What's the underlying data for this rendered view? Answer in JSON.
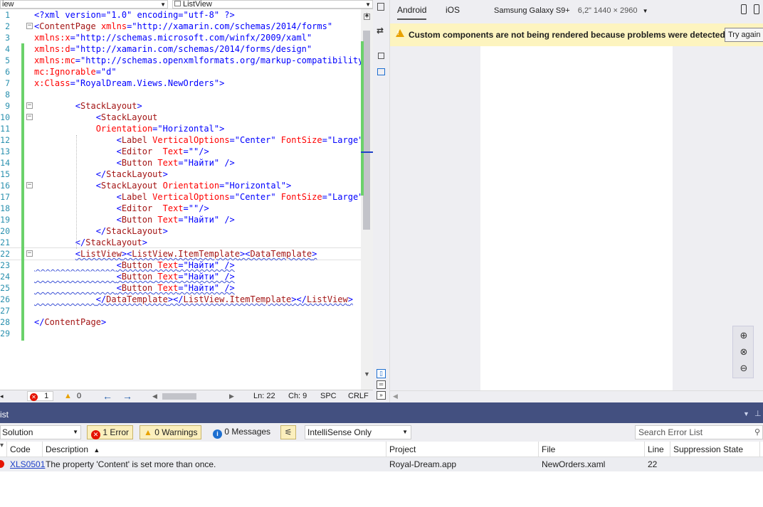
{
  "editor": {
    "combo_left": "iew",
    "combo_right": "ListView",
    "lines": [
      {
        "n": "1",
        "fold": "",
        "parts": [
          {
            "t": "<?xml version=\"1.0\" encoding=\"utf-8\" ?>",
            "c": "b"
          }
        ]
      },
      {
        "n": "2",
        "fold": "⊟",
        "parts": [
          {
            "t": "<",
            "c": "b"
          },
          {
            "t": "ContentPage",
            "c": "r"
          },
          {
            "t": " xmlns",
            "c": "a"
          },
          {
            "t": "=\"http://xamarin.com/schemas/2014/forms\"",
            "c": "v"
          }
        ]
      },
      {
        "n": "3",
        "fold": "",
        "parts": [
          {
            "t": "xmlns:x",
            "c": "a"
          },
          {
            "t": "=\"http://schemas.microsoft.com/winfx/2009/xaml\"",
            "c": "v"
          }
        ]
      },
      {
        "n": "4",
        "fold": "",
        "parts": [
          {
            "t": "xmlns:d",
            "c": "a"
          },
          {
            "t": "=\"http://xamarin.com/schemas/2014/forms/design\"",
            "c": "v"
          }
        ]
      },
      {
        "n": "5",
        "fold": "",
        "parts": [
          {
            "t": "xmlns:mc",
            "c": "a"
          },
          {
            "t": "=\"http://schemas.openxmlformats.org/markup-compatibility/2",
            "c": "v"
          }
        ]
      },
      {
        "n": "6",
        "fold": "",
        "parts": [
          {
            "t": "mc:Ignorable",
            "c": "a"
          },
          {
            "t": "=\"d\"",
            "c": "v"
          }
        ]
      },
      {
        "n": "7",
        "fold": "",
        "parts": [
          {
            "t": "x:Class",
            "c": "a"
          },
          {
            "t": "=\"RoyalDream.Views.NewOrders\">",
            "c": "v"
          }
        ]
      },
      {
        "n": "8",
        "fold": "",
        "parts": []
      },
      {
        "n": "9",
        "fold": "⊟",
        "parts": [
          {
            "t": "        <",
            "c": "b"
          },
          {
            "t": "StackLayout",
            "c": "r"
          },
          {
            "t": ">",
            "c": "b"
          }
        ]
      },
      {
        "n": "10",
        "fold": "⊟",
        "parts": [
          {
            "t": "            <",
            "c": "b"
          },
          {
            "t": "StackLayout",
            "c": "r"
          }
        ]
      },
      {
        "n": "11",
        "fold": "",
        "parts": [
          {
            "t": "            Orientation",
            "c": "a"
          },
          {
            "t": "=\"Horizontal\">",
            "c": "v"
          }
        ]
      },
      {
        "n": "12",
        "fold": "",
        "parts": [
          {
            "t": "                <",
            "c": "b"
          },
          {
            "t": "Label",
            "c": "r"
          },
          {
            "t": " VerticalOptions",
            "c": "a"
          },
          {
            "t": "=\"Center\"",
            "c": "v"
          },
          {
            "t": " FontSize",
            "c": "a"
          },
          {
            "t": "=\"Large\" ",
            "c": "v"
          }
        ]
      },
      {
        "n": "13",
        "fold": "",
        "parts": [
          {
            "t": "                <",
            "c": "b"
          },
          {
            "t": "Editor",
            "c": "r"
          },
          {
            "t": "  Text",
            "c": "a"
          },
          {
            "t": "=\"\"/>",
            "c": "v"
          }
        ]
      },
      {
        "n": "14",
        "fold": "",
        "parts": [
          {
            "t": "                <",
            "c": "b"
          },
          {
            "t": "Button",
            "c": "r"
          },
          {
            "t": " Text",
            "c": "a"
          },
          {
            "t": "=\"Найти\" />",
            "c": "v"
          }
        ]
      },
      {
        "n": "15",
        "fold": "",
        "parts": [
          {
            "t": "            </",
            "c": "b"
          },
          {
            "t": "StackLayout",
            "c": "r"
          },
          {
            "t": ">",
            "c": "b"
          }
        ]
      },
      {
        "n": "16",
        "fold": "⊟",
        "parts": [
          {
            "t": "            <",
            "c": "b"
          },
          {
            "t": "StackLayout",
            "c": "r"
          },
          {
            "t": " Orientation",
            "c": "a"
          },
          {
            "t": "=\"Horizontal\">",
            "c": "v"
          }
        ]
      },
      {
        "n": "17",
        "fold": "",
        "parts": [
          {
            "t": "                <",
            "c": "b"
          },
          {
            "t": "Label",
            "c": "r"
          },
          {
            "t": " VerticalOptions",
            "c": "a"
          },
          {
            "t": "=\"Center\"",
            "c": "v"
          },
          {
            "t": " FontSize",
            "c": "a"
          },
          {
            "t": "=\"Large\" ",
            "c": "v"
          }
        ]
      },
      {
        "n": "18",
        "fold": "",
        "parts": [
          {
            "t": "                <",
            "c": "b"
          },
          {
            "t": "Editor",
            "c": "r"
          },
          {
            "t": "  Text",
            "c": "a"
          },
          {
            "t": "=\"\"/>",
            "c": "v"
          }
        ]
      },
      {
        "n": "19",
        "fold": "",
        "parts": [
          {
            "t": "                <",
            "c": "b"
          },
          {
            "t": "Button",
            "c": "r"
          },
          {
            "t": " Text",
            "c": "a"
          },
          {
            "t": "=\"Найти\" />",
            "c": "v"
          }
        ]
      },
      {
        "n": "20",
        "fold": "",
        "parts": [
          {
            "t": "            </",
            "c": "b"
          },
          {
            "t": "StackLayout",
            "c": "r"
          },
          {
            "t": ">",
            "c": "b"
          }
        ]
      },
      {
        "n": "21",
        "fold": "",
        "parts": [
          {
            "t": "        </",
            "c": "b"
          },
          {
            "t": "StackLayout",
            "c": "r"
          },
          {
            "t": ">",
            "c": "b"
          }
        ]
      },
      {
        "n": "22",
        "fold": "⊟",
        "cur": true,
        "parts": [
          {
            "t": "        ",
            "c": "k"
          },
          {
            "t": "<",
            "c": "b",
            "s": true
          },
          {
            "t": "ListView",
            "c": "r",
            "s": true
          },
          {
            "t": "><",
            "c": "b",
            "s": true
          },
          {
            "t": "ListView.ItemTemplate",
            "c": "r",
            "s": true
          },
          {
            "t": "><",
            "c": "b",
            "s": true
          },
          {
            "t": "DataTemplate",
            "c": "r",
            "s": true
          },
          {
            "t": ">",
            "c": "b",
            "s": true
          }
        ]
      },
      {
        "n": "23",
        "fold": "",
        "parts": [
          {
            "t": "                ",
            "c": "k",
            "s": true
          },
          {
            "t": "<",
            "c": "b",
            "s": true
          },
          {
            "t": "Button",
            "c": "r",
            "s": true
          },
          {
            "t": " Text",
            "c": "a",
            "s": true
          },
          {
            "t": "=\"Найти\" />",
            "c": "v",
            "s": true
          }
        ]
      },
      {
        "n": "24",
        "fold": "",
        "parts": [
          {
            "t": "                ",
            "c": "k",
            "s": true
          },
          {
            "t": "<",
            "c": "b",
            "s": true
          },
          {
            "t": "Button",
            "c": "r",
            "s": true
          },
          {
            "t": " Text",
            "c": "a",
            "s": true
          },
          {
            "t": "=\"Найти\" />",
            "c": "v",
            "s": true
          }
        ]
      },
      {
        "n": "25",
        "fold": "",
        "parts": [
          {
            "t": "                ",
            "c": "k",
            "s": true
          },
          {
            "t": "<",
            "c": "b",
            "s": true
          },
          {
            "t": "Button",
            "c": "r",
            "s": true
          },
          {
            "t": " Text",
            "c": "a",
            "s": true
          },
          {
            "t": "=\"Найти\" />",
            "c": "v",
            "s": true
          }
        ]
      },
      {
        "n": "26",
        "fold": "",
        "parts": [
          {
            "t": "            ",
            "c": "k",
            "s": true
          },
          {
            "t": "</",
            "c": "b",
            "s": true
          },
          {
            "t": "DataTemplate",
            "c": "r",
            "s": true
          },
          {
            "t": "></",
            "c": "b",
            "s": true
          },
          {
            "t": "ListView.ItemTemplate",
            "c": "r",
            "s": true
          },
          {
            "t": "></",
            "c": "b",
            "s": true
          },
          {
            "t": "ListView",
            "c": "r",
            "s": true
          },
          {
            "t": ">",
            "c": "b",
            "s": true
          }
        ]
      },
      {
        "n": "27",
        "fold": "",
        "parts": []
      },
      {
        "n": "28",
        "fold": "",
        "parts": [
          {
            "t": "</",
            "c": "b"
          },
          {
            "t": "ContentPage",
            "c": "r"
          },
          {
            "t": ">",
            "c": "b"
          }
        ]
      },
      {
        "n": "29",
        "fold": "",
        "parts": []
      }
    ]
  },
  "editor_status": {
    "errors": "1",
    "warnings": "0",
    "ln": "Ln: 22",
    "ch": "Ch: 9",
    "spc": "SPC",
    "crlf": "CRLF"
  },
  "designer": {
    "tab_android": "Android",
    "tab_ios": "iOS",
    "device": "Samsung Galaxy S9+",
    "device_spec": "6,2\" 1440 × 2960",
    "warning_text": "Custom components are not being rendered because problems were detected.",
    "try_again": "Try again"
  },
  "error_list": {
    "title": "ist",
    "scope": "Solution",
    "errors_btn": "1 Error",
    "warnings_btn": "0 Warnings",
    "messages_btn": "0 Messages",
    "filter": "IntelliSense Only",
    "search_placeholder": "Search Error List",
    "columns": {
      "code": "Code",
      "description": "Description",
      "project": "Project",
      "file": "File",
      "line": "Line",
      "suppression": "Suppression State"
    },
    "row": {
      "code": "XLS0501",
      "description": "The property 'Content' is set more than once.",
      "project": "Royal-Dream.app",
      "file": "NewOrders.xaml",
      "line": "22"
    }
  },
  "colors": {
    "accent": "#435080",
    "warning_bg": "#fdf4bf",
    "error": "#e51400",
    "change_bar": "#6bd16b"
  }
}
